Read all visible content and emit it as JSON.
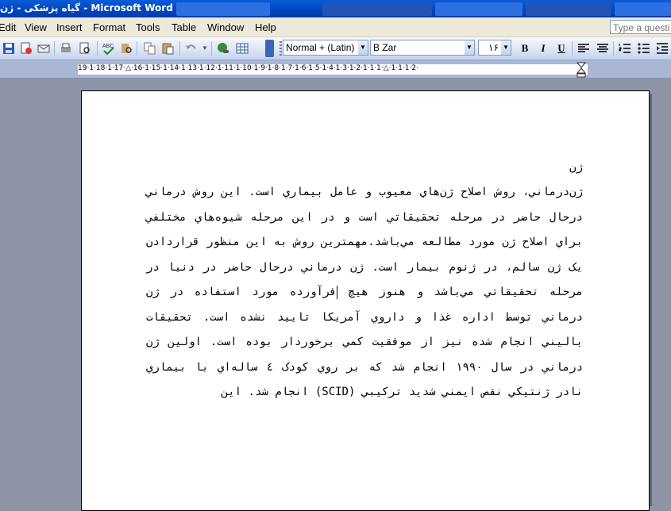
{
  "window": {
    "title": "گیاه پزشکی - ژن - Microsoft Word"
  },
  "menu": [
    "Edit",
    "View",
    "Insert",
    "Format",
    "Tools",
    "Table",
    "Window",
    "Help"
  ],
  "ask": {
    "placeholder": "Type a question"
  },
  "toolbar": {
    "style": "Normal + (Latin)",
    "font": "B Zar",
    "size": "۱۶",
    "bold": "B",
    "italic": "I",
    "underline": "U"
  },
  "ruler": {
    "numbers": "19·1·18·1·17·△·16·1·15·1·14·1·13·1·12·1·11·1·10·1·9·1·8·1·7·1·6·1·5·1·4·1·3·1·2·1·1·1·△·1·1·1·2·"
  },
  "document": {
    "heading": "ژن",
    "paragraph_before_cursor": "ژن‌درماني، روش اصلاح ژن‌هاي معيوب و عامل بيماري است. اين روش درماني درحال حاضر در مرحله تحقيقاتي است و در اين مرحله شيوه‌هاي مختلفي براي اصلاح ژن مورد مطالعه مي‌باشد.مهمترين روش به اين منظور قراردادن يک ژن سالم، در ژنوم بيمار است. ژن درماني درحال حاضر در دنيا در مرحله تحقيقاتي مي‌باشد و هنوز هيچ ",
    "paragraph_after_cursor": "فرآورده مورد استفاده در ژن درماني توسط اداره غذا و داروي آمريکا تاييد نشده است. تحقيقات باليني انجام شده نيز از موفقيت کمي برخوردار بوده است. اولين ژن درماني در سال ۱۹۹۰ انجام شد که بر روي کودک ٤ ساله‌اي با بيماري نادر ژنتيکي نقص ايمني شديد ترکيبي (SCID) انجام شد. اين"
  }
}
